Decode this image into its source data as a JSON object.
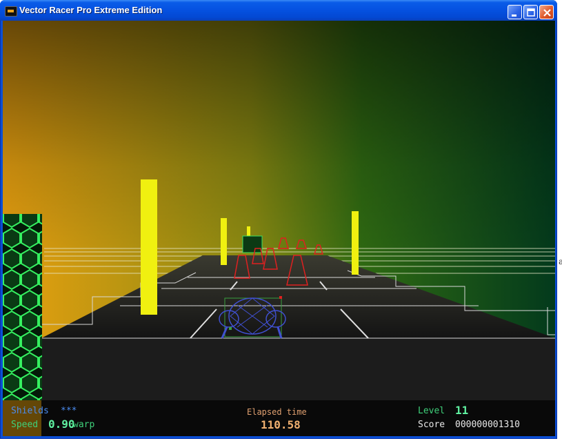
{
  "window": {
    "title": "Vector Racer Pro Extreme Edition",
    "minimize_icon": "minimize-icon",
    "maximize_icon": "maximize-icon",
    "close_icon": "close-icon"
  },
  "hud": {
    "shields_label": "Shields",
    "shields_value": "***",
    "speed_label": "Speed",
    "speed_value": "0.90",
    "speed_unit": "warp",
    "elapsed_label": "Elapsed time",
    "elapsed_value": "110.58",
    "level_label": "Level",
    "level_value": "11",
    "score_label": "Score",
    "score_value": "000000001310"
  },
  "colors": {
    "sky_left": "#e8a010",
    "sky_right": "#003a1a",
    "pillar": "#f0f010",
    "hex_wall": "#22d040",
    "ship": "#4050d0",
    "enemy": "#e02020"
  }
}
